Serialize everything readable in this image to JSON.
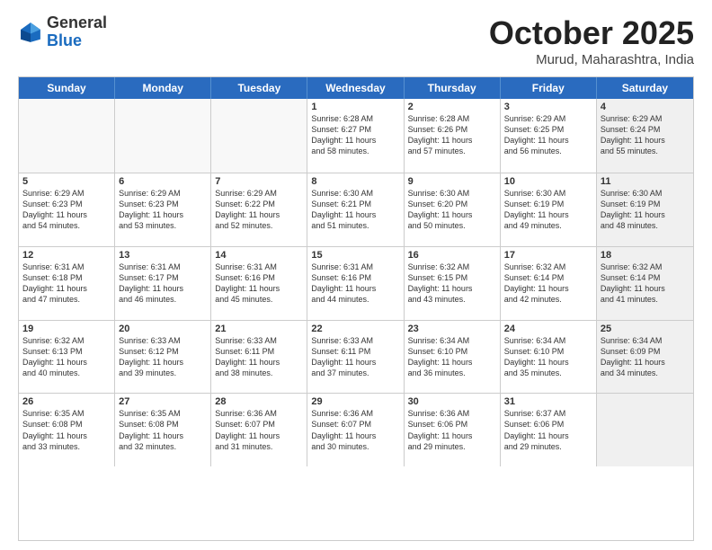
{
  "header": {
    "logo_general": "General",
    "logo_blue": "Blue",
    "month_title": "October 2025",
    "location": "Murud, Maharashtra, India"
  },
  "weekdays": [
    "Sunday",
    "Monday",
    "Tuesday",
    "Wednesday",
    "Thursday",
    "Friday",
    "Saturday"
  ],
  "rows": [
    [
      {
        "day": "",
        "text": "",
        "empty": true
      },
      {
        "day": "",
        "text": "",
        "empty": true
      },
      {
        "day": "",
        "text": "",
        "empty": true
      },
      {
        "day": "1",
        "text": "Sunrise: 6:28 AM\nSunset: 6:27 PM\nDaylight: 11 hours\nand 58 minutes.",
        "empty": false
      },
      {
        "day": "2",
        "text": "Sunrise: 6:28 AM\nSunset: 6:26 PM\nDaylight: 11 hours\nand 57 minutes.",
        "empty": false
      },
      {
        "day": "3",
        "text": "Sunrise: 6:29 AM\nSunset: 6:25 PM\nDaylight: 11 hours\nand 56 minutes.",
        "empty": false
      },
      {
        "day": "4",
        "text": "Sunrise: 6:29 AM\nSunset: 6:24 PM\nDaylight: 11 hours\nand 55 minutes.",
        "empty": false,
        "shaded": true
      }
    ],
    [
      {
        "day": "5",
        "text": "Sunrise: 6:29 AM\nSunset: 6:23 PM\nDaylight: 11 hours\nand 54 minutes.",
        "empty": false
      },
      {
        "day": "6",
        "text": "Sunrise: 6:29 AM\nSunset: 6:23 PM\nDaylight: 11 hours\nand 53 minutes.",
        "empty": false
      },
      {
        "day": "7",
        "text": "Sunrise: 6:29 AM\nSunset: 6:22 PM\nDaylight: 11 hours\nand 52 minutes.",
        "empty": false
      },
      {
        "day": "8",
        "text": "Sunrise: 6:30 AM\nSunset: 6:21 PM\nDaylight: 11 hours\nand 51 minutes.",
        "empty": false
      },
      {
        "day": "9",
        "text": "Sunrise: 6:30 AM\nSunset: 6:20 PM\nDaylight: 11 hours\nand 50 minutes.",
        "empty": false
      },
      {
        "day": "10",
        "text": "Sunrise: 6:30 AM\nSunset: 6:19 PM\nDaylight: 11 hours\nand 49 minutes.",
        "empty": false
      },
      {
        "day": "11",
        "text": "Sunrise: 6:30 AM\nSunset: 6:19 PM\nDaylight: 11 hours\nand 48 minutes.",
        "empty": false,
        "shaded": true
      }
    ],
    [
      {
        "day": "12",
        "text": "Sunrise: 6:31 AM\nSunset: 6:18 PM\nDaylight: 11 hours\nand 47 minutes.",
        "empty": false
      },
      {
        "day": "13",
        "text": "Sunrise: 6:31 AM\nSunset: 6:17 PM\nDaylight: 11 hours\nand 46 minutes.",
        "empty": false
      },
      {
        "day": "14",
        "text": "Sunrise: 6:31 AM\nSunset: 6:16 PM\nDaylight: 11 hours\nand 45 minutes.",
        "empty": false
      },
      {
        "day": "15",
        "text": "Sunrise: 6:31 AM\nSunset: 6:16 PM\nDaylight: 11 hours\nand 44 minutes.",
        "empty": false
      },
      {
        "day": "16",
        "text": "Sunrise: 6:32 AM\nSunset: 6:15 PM\nDaylight: 11 hours\nand 43 minutes.",
        "empty": false
      },
      {
        "day": "17",
        "text": "Sunrise: 6:32 AM\nSunset: 6:14 PM\nDaylight: 11 hours\nand 42 minutes.",
        "empty": false
      },
      {
        "day": "18",
        "text": "Sunrise: 6:32 AM\nSunset: 6:14 PM\nDaylight: 11 hours\nand 41 minutes.",
        "empty": false,
        "shaded": true
      }
    ],
    [
      {
        "day": "19",
        "text": "Sunrise: 6:32 AM\nSunset: 6:13 PM\nDaylight: 11 hours\nand 40 minutes.",
        "empty": false
      },
      {
        "day": "20",
        "text": "Sunrise: 6:33 AM\nSunset: 6:12 PM\nDaylight: 11 hours\nand 39 minutes.",
        "empty": false
      },
      {
        "day": "21",
        "text": "Sunrise: 6:33 AM\nSunset: 6:11 PM\nDaylight: 11 hours\nand 38 minutes.",
        "empty": false
      },
      {
        "day": "22",
        "text": "Sunrise: 6:33 AM\nSunset: 6:11 PM\nDaylight: 11 hours\nand 37 minutes.",
        "empty": false
      },
      {
        "day": "23",
        "text": "Sunrise: 6:34 AM\nSunset: 6:10 PM\nDaylight: 11 hours\nand 36 minutes.",
        "empty": false
      },
      {
        "day": "24",
        "text": "Sunrise: 6:34 AM\nSunset: 6:10 PM\nDaylight: 11 hours\nand 35 minutes.",
        "empty": false
      },
      {
        "day": "25",
        "text": "Sunrise: 6:34 AM\nSunset: 6:09 PM\nDaylight: 11 hours\nand 34 minutes.",
        "empty": false,
        "shaded": true
      }
    ],
    [
      {
        "day": "26",
        "text": "Sunrise: 6:35 AM\nSunset: 6:08 PM\nDaylight: 11 hours\nand 33 minutes.",
        "empty": false
      },
      {
        "day": "27",
        "text": "Sunrise: 6:35 AM\nSunset: 6:08 PM\nDaylight: 11 hours\nand 32 minutes.",
        "empty": false
      },
      {
        "day": "28",
        "text": "Sunrise: 6:36 AM\nSunset: 6:07 PM\nDaylight: 11 hours\nand 31 minutes.",
        "empty": false
      },
      {
        "day": "29",
        "text": "Sunrise: 6:36 AM\nSunset: 6:07 PM\nDaylight: 11 hours\nand 30 minutes.",
        "empty": false
      },
      {
        "day": "30",
        "text": "Sunrise: 6:36 AM\nSunset: 6:06 PM\nDaylight: 11 hours\nand 29 minutes.",
        "empty": false
      },
      {
        "day": "31",
        "text": "Sunrise: 6:37 AM\nSunset: 6:06 PM\nDaylight: 11 hours\nand 29 minutes.",
        "empty": false
      },
      {
        "day": "",
        "text": "",
        "empty": true,
        "shaded": true
      }
    ]
  ]
}
